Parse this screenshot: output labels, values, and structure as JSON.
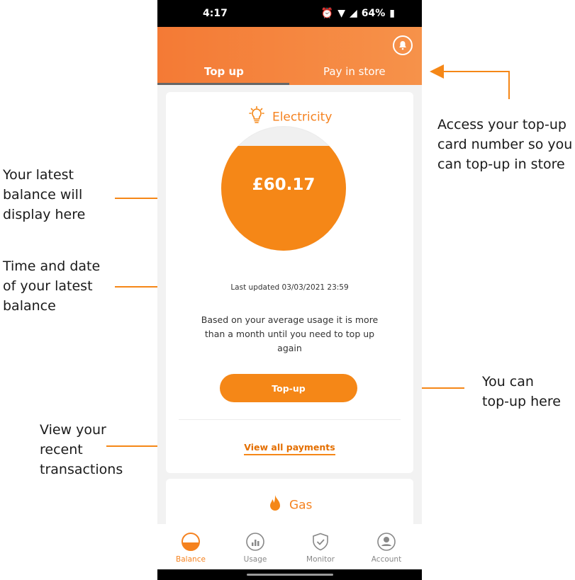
{
  "status_bar": {
    "time": "4:17",
    "battery": "64%"
  },
  "tabs": [
    {
      "label": "Top up",
      "active": true
    },
    {
      "label": "Pay in store",
      "active": false
    }
  ],
  "electricity": {
    "title": "Electricity",
    "balance": "£60.17",
    "gauge_fill_fraction": 0.84,
    "last_updated": "Last updated 03/03/2021 23:59",
    "forecast_text": "Based on your average usage it is more than a month until you need to top up again",
    "topup_button": "Top-up",
    "view_payments_link": "View all payments"
  },
  "gas": {
    "title": "Gas"
  },
  "bottom_nav": [
    {
      "label": "Balance",
      "icon": "balance-icon",
      "active": true
    },
    {
      "label": "Usage",
      "icon": "usage-icon",
      "active": false
    },
    {
      "label": "Monitor",
      "icon": "shield-check-icon",
      "active": false
    },
    {
      "label": "Account",
      "icon": "account-icon",
      "active": false
    }
  ],
  "annotations": {
    "latest_balance": [
      "Your latest",
      "balance will",
      "display here"
    ],
    "time_date": [
      "Time and date",
      "of your latest",
      "balance"
    ],
    "recent_transactions": [
      "View your",
      "recent",
      "transactions"
    ],
    "access_card": [
      "Access your top-up",
      "card number so you",
      "can top-up in store"
    ],
    "topup_here": [
      "You can",
      "top-up here"
    ]
  },
  "colors": {
    "accent": "#f58717",
    "header_start": "#f47a35",
    "header_end": "#f6924a"
  }
}
